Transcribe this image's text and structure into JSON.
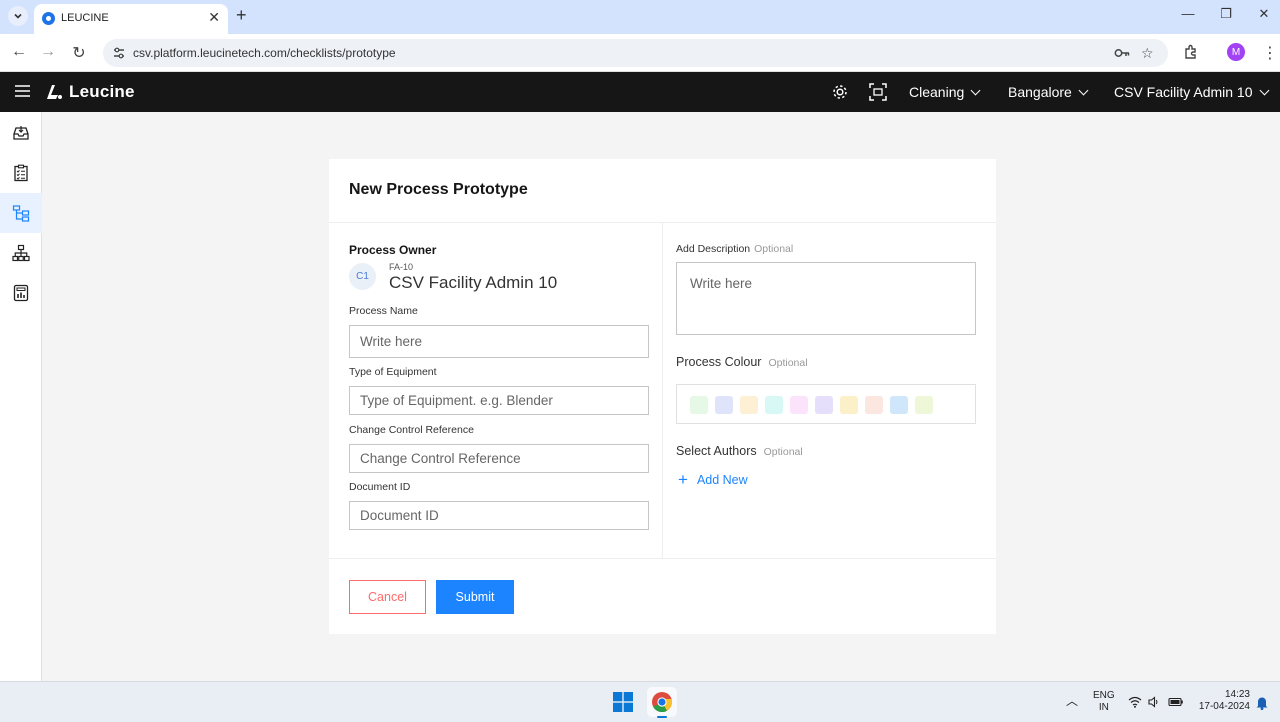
{
  "browser": {
    "tab_title": "LEUCINE",
    "url": "csv.platform.leucinetech.com/checklists/prototype",
    "profile_initial": "M"
  },
  "app": {
    "logo_text": "Leucine",
    "header": {
      "use_case": "Cleaning",
      "facility": "Bangalore",
      "user": "CSV Facility Admin 10"
    }
  },
  "form": {
    "title": "New Process Prototype",
    "owner": {
      "label": "Process Owner",
      "initials": "C1",
      "id": "FA-10",
      "name": "CSV Facility Admin 10"
    },
    "process_name": {
      "label": "Process Name",
      "placeholder": "Write here"
    },
    "equipment": {
      "label": "Type of Equipment",
      "placeholder": "Type of Equipment. e.g. Blender"
    },
    "change_control": {
      "label": "Change Control Reference",
      "placeholder": "Change Control Reference"
    },
    "document_id": {
      "label": "Document ID",
      "placeholder": "Document ID"
    },
    "description": {
      "label": "Add Description",
      "optional": "Optional",
      "placeholder": "Write here"
    },
    "colour": {
      "label": "Process Colour",
      "optional": "Optional",
      "swatches": [
        "#e6f8e6",
        "#dfe4fb",
        "#fdf0d5",
        "#d8f8f6",
        "#fbe4fb",
        "#e6dffb",
        "#fbf0c8",
        "#fbe6e0",
        "#cfe6fb",
        "#eef8d8"
      ]
    },
    "authors": {
      "label": "Select Authors",
      "optional": "Optional",
      "add_label": "Add New"
    },
    "cancel_label": "Cancel",
    "submit_label": "Submit"
  },
  "taskbar": {
    "lang_line1": "ENG",
    "lang_line2": "IN",
    "time": "14:23",
    "date": "17-04-2024"
  },
  "colors": {
    "accent": "#1d84ff",
    "danger": "#ff6b6b",
    "header_bg": "#161616"
  }
}
